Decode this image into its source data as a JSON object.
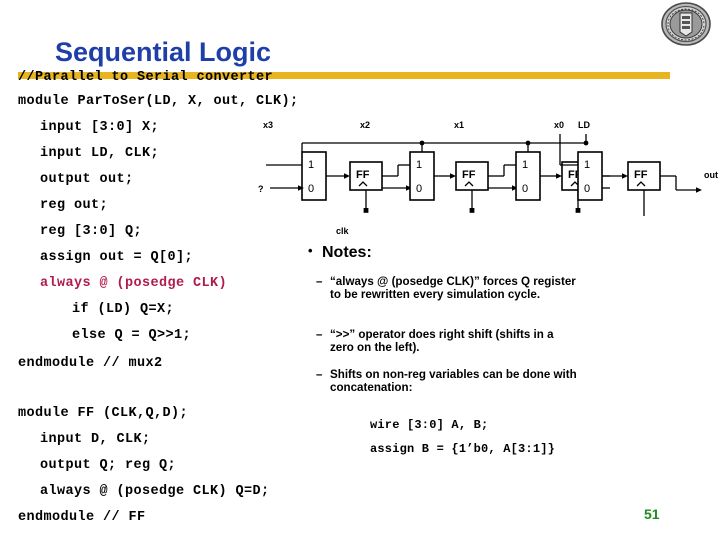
{
  "slide": {
    "title": "Sequential Logic",
    "page_number": "51",
    "accent_rule_color": "#e8b521",
    "title_color": "#1f3fa8",
    "page_number_color": "#1e8c1e",
    "highlight_code_color": "#b01c4e"
  },
  "logo": {
    "name": "university-seal-logo"
  },
  "code_left": {
    "comment": "//Parallel to Serial converter",
    "lines": [
      "module ParToSer(LD, X, out, CLK);",
      "input [3:0] X;",
      "input LD, CLK;",
      "output out;",
      "reg out;",
      "reg [3:0] Q;",
      "assign out = Q[0];",
      "always @ (posedge CLK)",
      "if (LD) Q=X;",
      "else Q = Q>>1;",
      "endmodule // mux2"
    ],
    "highlighted_line_index": 7
  },
  "code_bottom": {
    "lines": [
      "module FF (CLK,Q,D);",
      "input D, CLK;",
      "output Q; reg Q;",
      "always @ (posedge CLK) Q=D;",
      "endmodule // FF"
    ]
  },
  "notes": {
    "bullet": "•",
    "heading": "Notes:",
    "dash": "–",
    "items": [
      "“always @ (posedge CLK)” forces Q register to be rewritten every simulation cycle.",
      "“>>” operator does right shift (shifts in a zero on the left).",
      "Shifts on non-reg variables can be done with concatenation:"
    ],
    "code_examples": [
      "wire [3:0] A, B;",
      "assign B = {1’b0, A[3:1]}"
    ]
  },
  "diagram": {
    "name": "parallel-to-serial-shift-register",
    "input_labels": [
      "x3",
      "x2",
      "x1",
      "x0"
    ],
    "control_label": "LD",
    "clock_label": "clk",
    "output_label": "out",
    "unknown_input_label": "?",
    "mux_select_high": "1",
    "mux_select_low": "0",
    "ff_label": "FF",
    "mux_count": 4,
    "ff_count": 4
  }
}
